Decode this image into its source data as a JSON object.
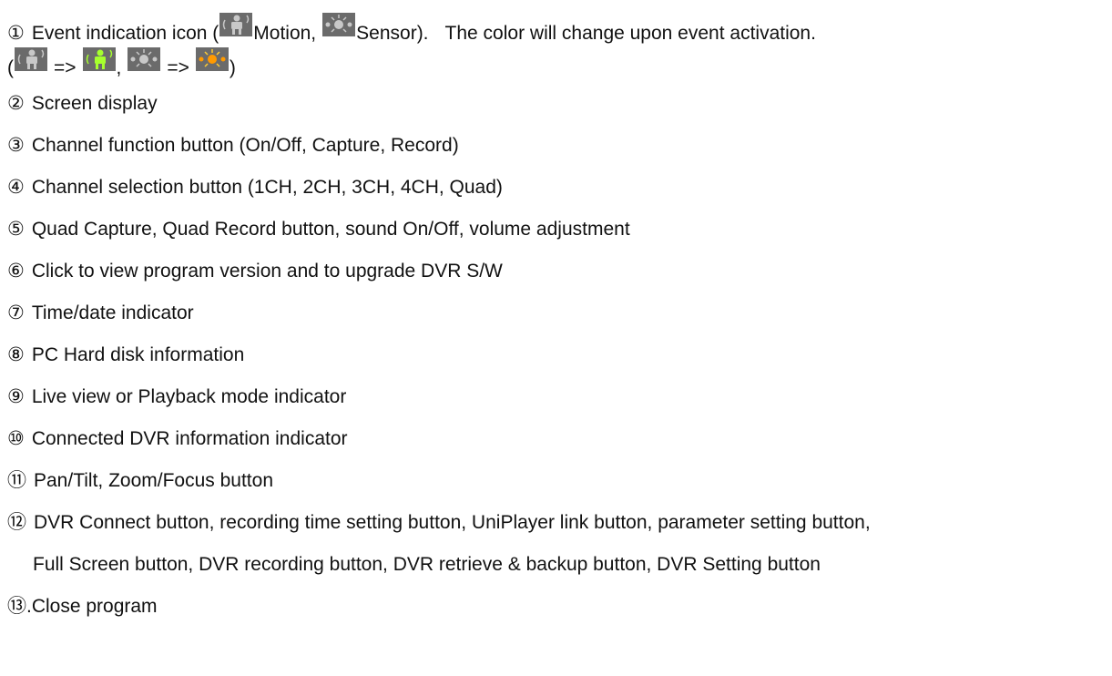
{
  "items": [
    {
      "num": "①",
      "pre": "Event indication icon (",
      "motion_label": "Motion,",
      "sensor_label": "Sensor).",
      "post": "The color will change upon event activation."
    },
    {
      "open_paren": "(",
      "arrow1": "=>",
      "comma": ",",
      "arrow2": "=>",
      "close_paren": ")"
    },
    {
      "num": "②",
      "text": "Screen display"
    },
    {
      "num": "③",
      "text": "Channel function button (On/Off, Capture, Record)"
    },
    {
      "num": "④",
      "text": "Channel selection button (1CH, 2CH, 3CH, 4CH, Quad)"
    },
    {
      "num": "⑤",
      "text": "Quad Capture, Quad Record button, sound On/Off, volume adjustment"
    },
    {
      "num": "⑥",
      "text": "Click to view program version and to upgrade DVR S/W"
    },
    {
      "num": "⑦",
      "text": "Time/date indicator"
    },
    {
      "num": "⑧",
      "text": "PC Hard disk information"
    },
    {
      "num": "⑨",
      "text": "Live view or Playback mode indicator"
    },
    {
      "num": "⑩",
      "text": "Connected DVR information indicator"
    },
    {
      "num": "⑪",
      "text": "Pan/Tilt, Zoom/Focus button"
    },
    {
      "num": "⑫",
      "text": "DVR Connect button, recording time setting button, UniPlayer link button, parameter setting button,"
    },
    {
      "text": "Full Screen button, DVR recording button, DVR retrieve & backup button, DVR Setting button"
    },
    {
      "num": "⑬",
      "text": ".Close program"
    }
  ],
  "icons": {
    "motion_idle": "motion-icon",
    "sensor_idle": "sensor-icon",
    "motion_active": "motion-active-icon",
    "sensor_active": "sensor-active-icon"
  },
  "colors": {
    "icon_bg": "#6b6b6b",
    "idle_figure": "#c8c8c8",
    "motion_active": "#a6ff2e",
    "sensor_active": "#ff9a00"
  }
}
